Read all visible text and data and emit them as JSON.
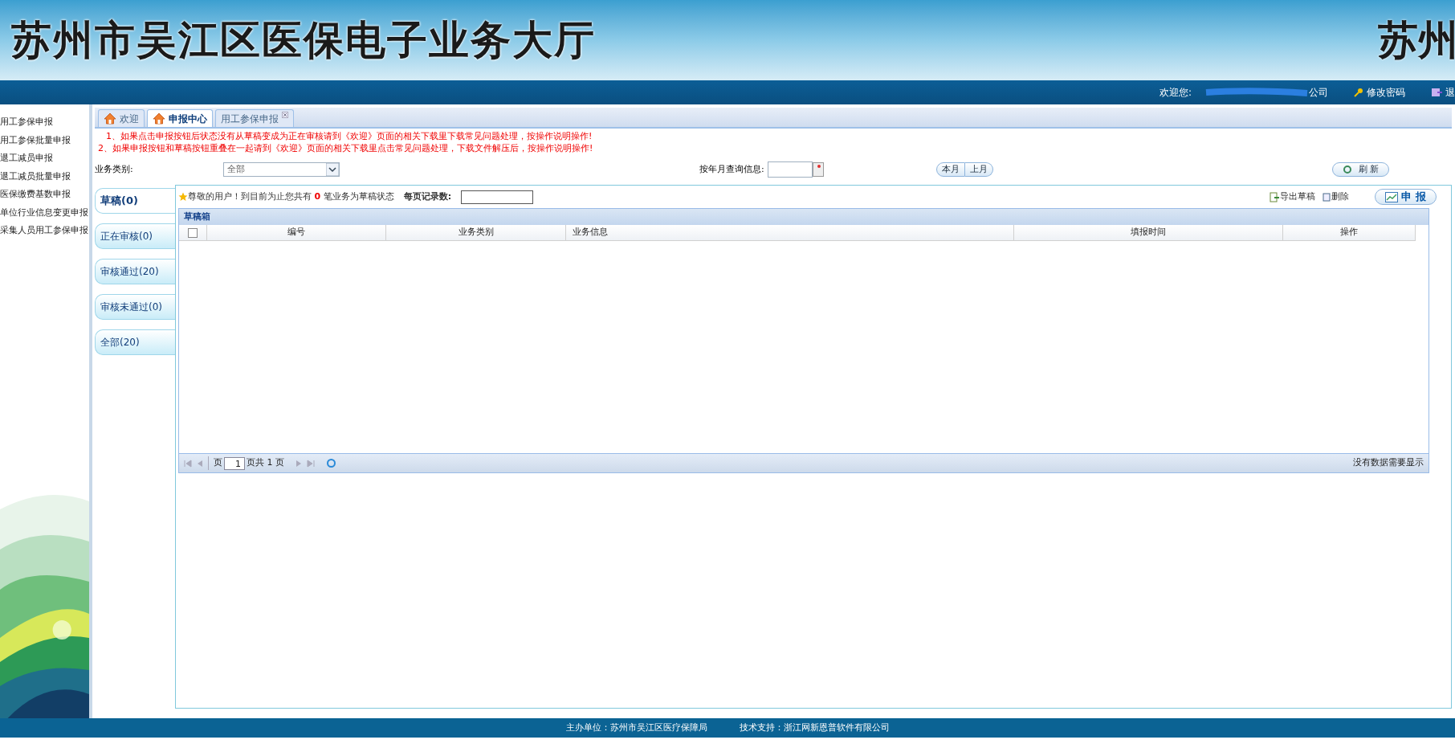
{
  "header": {
    "title": "苏州市吴江区医保电子业务大厅",
    "title_cut": "苏州"
  },
  "top_bar": {
    "welcome": "欢迎您:",
    "company_tail": "公司",
    "links": [
      {
        "label": "修改密码",
        "kind": "key"
      },
      {
        "label": "退",
        "kind": "exit"
      }
    ]
  },
  "sidebar": {
    "items": [
      {
        "label": "用工参保申报"
      },
      {
        "label": "用工参保批量申报"
      },
      {
        "label": "退工减员申报"
      },
      {
        "label": "退工减员批量申报"
      },
      {
        "label": "医保缴费基数申报"
      },
      {
        "label": "单位行业信息变更申报"
      },
      {
        "label": "采集人员用工参保申报"
      }
    ]
  },
  "tabs": [
    {
      "label": "欢迎",
      "selected": false,
      "kind": "home"
    },
    {
      "label": "申报中心",
      "selected": true,
      "kind": "home"
    },
    {
      "label": "用工参保申报",
      "selected": false,
      "kind": "closable"
    }
  ],
  "notices": [
    "1、如果点击申报按钮后状态没有从草稿变成为正在审核请到《欢迎》页面的相关下载里下载常见问题处理，按操作说明操作!",
    "2、如果申报按钮和草稿按钮重叠在一起请到《欢迎》页面的相关下载里点击常见问题处理，下载文件解压后，按操作说明操作!"
  ],
  "filters": {
    "category_label": "业务类别:",
    "category_value": "全部",
    "month_label": "按年月查询信息:",
    "month_buttons": [
      "本月",
      "上月"
    ],
    "refresh": "刷 新"
  },
  "status_tabs": [
    {
      "label": "草稿(0)",
      "selected": true
    },
    {
      "label": "正在审核(0)",
      "selected": false
    },
    {
      "label": "审核通过(20)",
      "selected": false
    },
    {
      "label": "审核未通过(0)",
      "selected": false
    },
    {
      "label": "全部(20)",
      "selected": false
    }
  ],
  "toolbar": {
    "message": "尊敬的用户！到目前为止您共有 **0** 笔业务为草稿状态",
    "page_size_label": "每页记录数:",
    "actions": [
      {
        "label": "导出草稿",
        "kind": "export"
      },
      {
        "label": "删除",
        "kind": "delete"
      }
    ],
    "submit": "申 报"
  },
  "table": {
    "title": "草稿箱",
    "select_all": {
      "checked": false
    },
    "columns": [
      "编号",
      "业务类别",
      "业务信息",
      "填报时间",
      "操作"
    ]
  },
  "pager": {
    "page_label": "页",
    "page_value": "1",
    "total": "页共 1 页",
    "empty": "没有数据需要显示"
  },
  "footer": {
    "host": "主办单位：苏州市吴江区医疗保障局",
    "support": "技术支持：浙江网新恩普软件有限公司"
  }
}
